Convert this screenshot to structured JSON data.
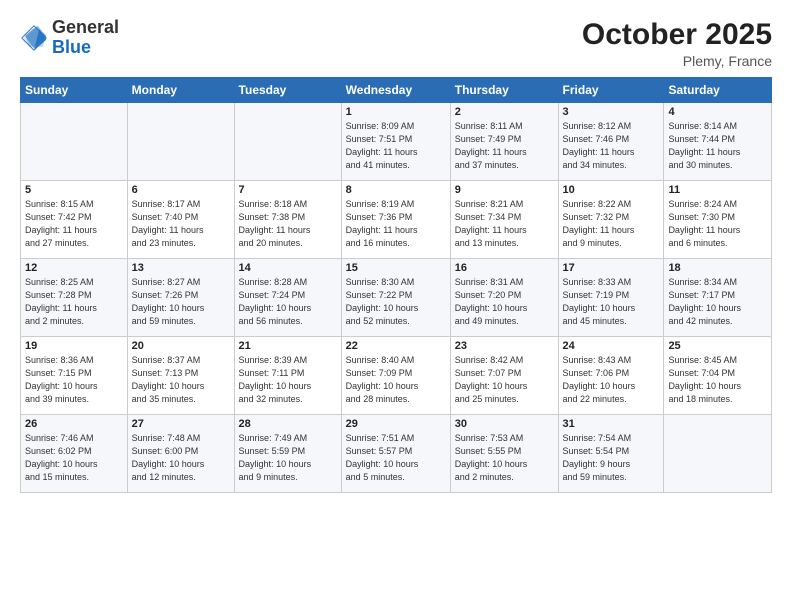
{
  "header": {
    "logo_general": "General",
    "logo_blue": "Blue",
    "month_title": "October 2025",
    "location": "Plemy, France"
  },
  "columns": [
    "Sunday",
    "Monday",
    "Tuesday",
    "Wednesday",
    "Thursday",
    "Friday",
    "Saturday"
  ],
  "weeks": [
    [
      {
        "day": "",
        "info": ""
      },
      {
        "day": "",
        "info": ""
      },
      {
        "day": "",
        "info": ""
      },
      {
        "day": "1",
        "info": "Sunrise: 8:09 AM\nSunset: 7:51 PM\nDaylight: 11 hours\nand 41 minutes."
      },
      {
        "day": "2",
        "info": "Sunrise: 8:11 AM\nSunset: 7:49 PM\nDaylight: 11 hours\nand 37 minutes."
      },
      {
        "day": "3",
        "info": "Sunrise: 8:12 AM\nSunset: 7:46 PM\nDaylight: 11 hours\nand 34 minutes."
      },
      {
        "day": "4",
        "info": "Sunrise: 8:14 AM\nSunset: 7:44 PM\nDaylight: 11 hours\nand 30 minutes."
      }
    ],
    [
      {
        "day": "5",
        "info": "Sunrise: 8:15 AM\nSunset: 7:42 PM\nDaylight: 11 hours\nand 27 minutes."
      },
      {
        "day": "6",
        "info": "Sunrise: 8:17 AM\nSunset: 7:40 PM\nDaylight: 11 hours\nand 23 minutes."
      },
      {
        "day": "7",
        "info": "Sunrise: 8:18 AM\nSunset: 7:38 PM\nDaylight: 11 hours\nand 20 minutes."
      },
      {
        "day": "8",
        "info": "Sunrise: 8:19 AM\nSunset: 7:36 PM\nDaylight: 11 hours\nand 16 minutes."
      },
      {
        "day": "9",
        "info": "Sunrise: 8:21 AM\nSunset: 7:34 PM\nDaylight: 11 hours\nand 13 minutes."
      },
      {
        "day": "10",
        "info": "Sunrise: 8:22 AM\nSunset: 7:32 PM\nDaylight: 11 hours\nand 9 minutes."
      },
      {
        "day": "11",
        "info": "Sunrise: 8:24 AM\nSunset: 7:30 PM\nDaylight: 11 hours\nand 6 minutes."
      }
    ],
    [
      {
        "day": "12",
        "info": "Sunrise: 8:25 AM\nSunset: 7:28 PM\nDaylight: 11 hours\nand 2 minutes."
      },
      {
        "day": "13",
        "info": "Sunrise: 8:27 AM\nSunset: 7:26 PM\nDaylight: 10 hours\nand 59 minutes."
      },
      {
        "day": "14",
        "info": "Sunrise: 8:28 AM\nSunset: 7:24 PM\nDaylight: 10 hours\nand 56 minutes."
      },
      {
        "day": "15",
        "info": "Sunrise: 8:30 AM\nSunset: 7:22 PM\nDaylight: 10 hours\nand 52 minutes."
      },
      {
        "day": "16",
        "info": "Sunrise: 8:31 AM\nSunset: 7:20 PM\nDaylight: 10 hours\nand 49 minutes."
      },
      {
        "day": "17",
        "info": "Sunrise: 8:33 AM\nSunset: 7:19 PM\nDaylight: 10 hours\nand 45 minutes."
      },
      {
        "day": "18",
        "info": "Sunrise: 8:34 AM\nSunset: 7:17 PM\nDaylight: 10 hours\nand 42 minutes."
      }
    ],
    [
      {
        "day": "19",
        "info": "Sunrise: 8:36 AM\nSunset: 7:15 PM\nDaylight: 10 hours\nand 39 minutes."
      },
      {
        "day": "20",
        "info": "Sunrise: 8:37 AM\nSunset: 7:13 PM\nDaylight: 10 hours\nand 35 minutes."
      },
      {
        "day": "21",
        "info": "Sunrise: 8:39 AM\nSunset: 7:11 PM\nDaylight: 10 hours\nand 32 minutes."
      },
      {
        "day": "22",
        "info": "Sunrise: 8:40 AM\nSunset: 7:09 PM\nDaylight: 10 hours\nand 28 minutes."
      },
      {
        "day": "23",
        "info": "Sunrise: 8:42 AM\nSunset: 7:07 PM\nDaylight: 10 hours\nand 25 minutes."
      },
      {
        "day": "24",
        "info": "Sunrise: 8:43 AM\nSunset: 7:06 PM\nDaylight: 10 hours\nand 22 minutes."
      },
      {
        "day": "25",
        "info": "Sunrise: 8:45 AM\nSunset: 7:04 PM\nDaylight: 10 hours\nand 18 minutes."
      }
    ],
    [
      {
        "day": "26",
        "info": "Sunrise: 7:46 AM\nSunset: 6:02 PM\nDaylight: 10 hours\nand 15 minutes."
      },
      {
        "day": "27",
        "info": "Sunrise: 7:48 AM\nSunset: 6:00 PM\nDaylight: 10 hours\nand 12 minutes."
      },
      {
        "day": "28",
        "info": "Sunrise: 7:49 AM\nSunset: 5:59 PM\nDaylight: 10 hours\nand 9 minutes."
      },
      {
        "day": "29",
        "info": "Sunrise: 7:51 AM\nSunset: 5:57 PM\nDaylight: 10 hours\nand 5 minutes."
      },
      {
        "day": "30",
        "info": "Sunrise: 7:53 AM\nSunset: 5:55 PM\nDaylight: 10 hours\nand 2 minutes."
      },
      {
        "day": "31",
        "info": "Sunrise: 7:54 AM\nSunset: 5:54 PM\nDaylight: 9 hours\nand 59 minutes."
      },
      {
        "day": "",
        "info": ""
      }
    ]
  ]
}
